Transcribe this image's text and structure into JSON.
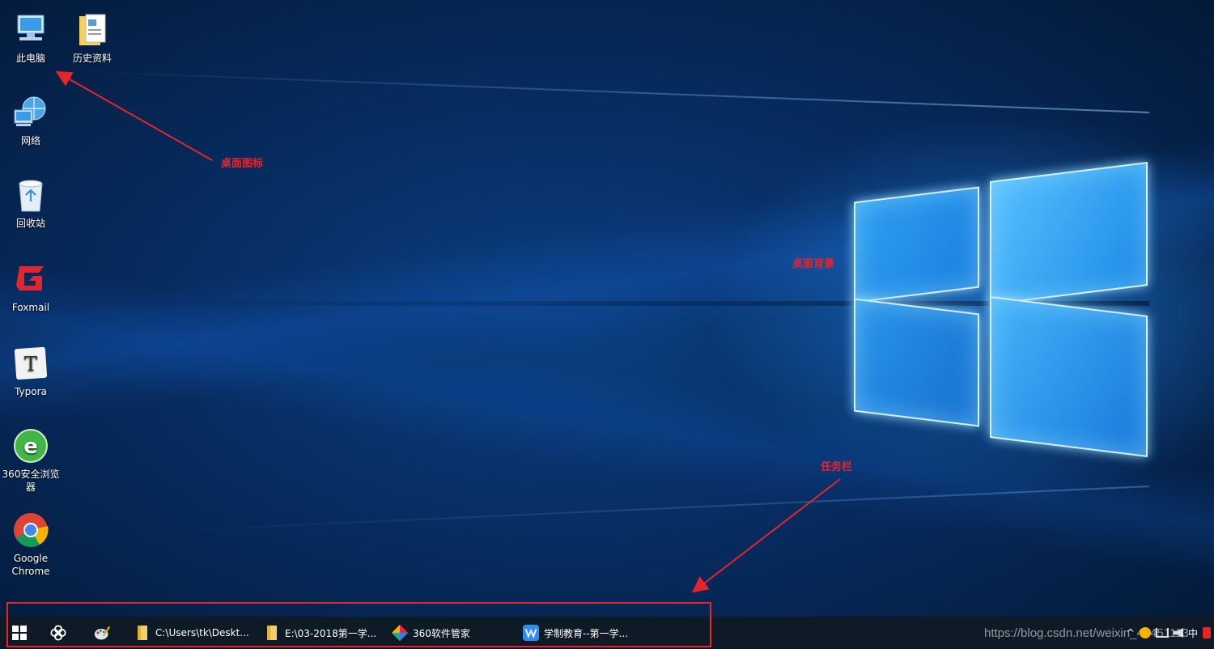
{
  "desktop_icons": [
    {
      "name": "computer-icon",
      "label": "此电脑"
    },
    {
      "name": "folder-icon",
      "label": "历史资料"
    },
    {
      "name": "network-icon",
      "label": "网络"
    },
    {
      "name": "recycle-bin-icon",
      "label": "回收站"
    },
    {
      "name": "foxmail-icon",
      "label": "Foxmail"
    },
    {
      "name": "typora-icon",
      "label": "Typora"
    },
    {
      "name": "360-browser-icon",
      "label": "360安全浏览器"
    },
    {
      "name": "chrome-icon",
      "label": "Google Chrome"
    }
  ],
  "annotations": {
    "desktop_icons": "桌面图标",
    "desktop_background": "桌面背景",
    "taskbar": "任务栏"
  },
  "taskbar": {
    "items": [
      {
        "icon": "windows-start-icon",
        "label": ""
      },
      {
        "icon": "pinwheel-icon",
        "label": ""
      },
      {
        "icon": "paint-palette-icon",
        "label": ""
      },
      {
        "icon": "folder-icon",
        "label": "C:\\Users\\tk\\Deskt..."
      },
      {
        "icon": "folder-icon",
        "label": "E:\\03-2018第一学..."
      },
      {
        "icon": "360-software-manager-icon",
        "label": "360软件管家"
      },
      {
        "icon": "wps-icon",
        "label": "学制教育--第一学..."
      }
    ],
    "tray_label": "中"
  },
  "watermark": "https://blog.csdn.net/weixin_43451113",
  "colors": {
    "annotation": "#e8242b",
    "taskbar": "#0f1a27",
    "accent": "#1a7fe0"
  }
}
